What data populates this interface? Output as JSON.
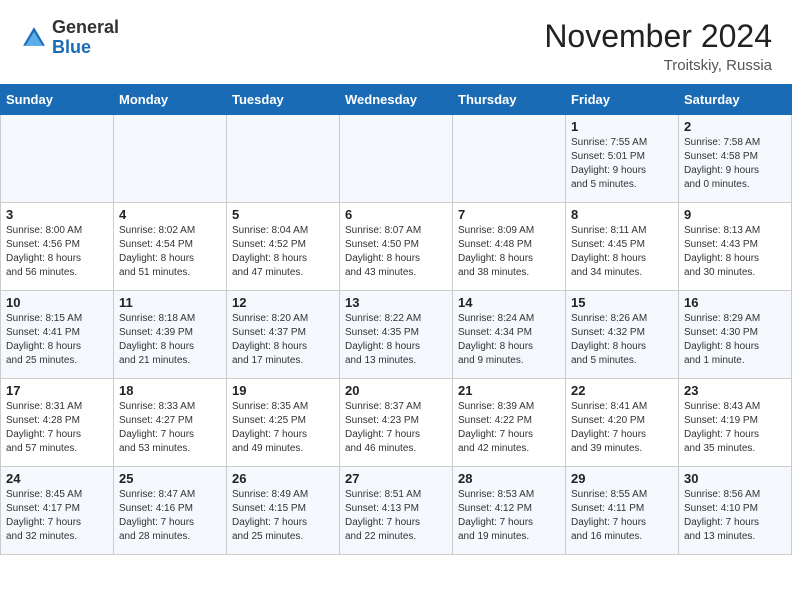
{
  "header": {
    "logo_general": "General",
    "logo_blue": "Blue",
    "month": "November 2024",
    "location": "Troitskiy, Russia"
  },
  "weekdays": [
    "Sunday",
    "Monday",
    "Tuesday",
    "Wednesday",
    "Thursday",
    "Friday",
    "Saturday"
  ],
  "weeks": [
    [
      {
        "day": "",
        "info": ""
      },
      {
        "day": "",
        "info": ""
      },
      {
        "day": "",
        "info": ""
      },
      {
        "day": "",
        "info": ""
      },
      {
        "day": "",
        "info": ""
      },
      {
        "day": "1",
        "info": "Sunrise: 7:55 AM\nSunset: 5:01 PM\nDaylight: 9 hours\nand 5 minutes."
      },
      {
        "day": "2",
        "info": "Sunrise: 7:58 AM\nSunset: 4:58 PM\nDaylight: 9 hours\nand 0 minutes."
      }
    ],
    [
      {
        "day": "3",
        "info": "Sunrise: 8:00 AM\nSunset: 4:56 PM\nDaylight: 8 hours\nand 56 minutes."
      },
      {
        "day": "4",
        "info": "Sunrise: 8:02 AM\nSunset: 4:54 PM\nDaylight: 8 hours\nand 51 minutes."
      },
      {
        "day": "5",
        "info": "Sunrise: 8:04 AM\nSunset: 4:52 PM\nDaylight: 8 hours\nand 47 minutes."
      },
      {
        "day": "6",
        "info": "Sunrise: 8:07 AM\nSunset: 4:50 PM\nDaylight: 8 hours\nand 43 minutes."
      },
      {
        "day": "7",
        "info": "Sunrise: 8:09 AM\nSunset: 4:48 PM\nDaylight: 8 hours\nand 38 minutes."
      },
      {
        "day": "8",
        "info": "Sunrise: 8:11 AM\nSunset: 4:45 PM\nDaylight: 8 hours\nand 34 minutes."
      },
      {
        "day": "9",
        "info": "Sunrise: 8:13 AM\nSunset: 4:43 PM\nDaylight: 8 hours\nand 30 minutes."
      }
    ],
    [
      {
        "day": "10",
        "info": "Sunrise: 8:15 AM\nSunset: 4:41 PM\nDaylight: 8 hours\nand 25 minutes."
      },
      {
        "day": "11",
        "info": "Sunrise: 8:18 AM\nSunset: 4:39 PM\nDaylight: 8 hours\nand 21 minutes."
      },
      {
        "day": "12",
        "info": "Sunrise: 8:20 AM\nSunset: 4:37 PM\nDaylight: 8 hours\nand 17 minutes."
      },
      {
        "day": "13",
        "info": "Sunrise: 8:22 AM\nSunset: 4:35 PM\nDaylight: 8 hours\nand 13 minutes."
      },
      {
        "day": "14",
        "info": "Sunrise: 8:24 AM\nSunset: 4:34 PM\nDaylight: 8 hours\nand 9 minutes."
      },
      {
        "day": "15",
        "info": "Sunrise: 8:26 AM\nSunset: 4:32 PM\nDaylight: 8 hours\nand 5 minutes."
      },
      {
        "day": "16",
        "info": "Sunrise: 8:29 AM\nSunset: 4:30 PM\nDaylight: 8 hours\nand 1 minute."
      }
    ],
    [
      {
        "day": "17",
        "info": "Sunrise: 8:31 AM\nSunset: 4:28 PM\nDaylight: 7 hours\nand 57 minutes."
      },
      {
        "day": "18",
        "info": "Sunrise: 8:33 AM\nSunset: 4:27 PM\nDaylight: 7 hours\nand 53 minutes."
      },
      {
        "day": "19",
        "info": "Sunrise: 8:35 AM\nSunset: 4:25 PM\nDaylight: 7 hours\nand 49 minutes."
      },
      {
        "day": "20",
        "info": "Sunrise: 8:37 AM\nSunset: 4:23 PM\nDaylight: 7 hours\nand 46 minutes."
      },
      {
        "day": "21",
        "info": "Sunrise: 8:39 AM\nSunset: 4:22 PM\nDaylight: 7 hours\nand 42 minutes."
      },
      {
        "day": "22",
        "info": "Sunrise: 8:41 AM\nSunset: 4:20 PM\nDaylight: 7 hours\nand 39 minutes."
      },
      {
        "day": "23",
        "info": "Sunrise: 8:43 AM\nSunset: 4:19 PM\nDaylight: 7 hours\nand 35 minutes."
      }
    ],
    [
      {
        "day": "24",
        "info": "Sunrise: 8:45 AM\nSunset: 4:17 PM\nDaylight: 7 hours\nand 32 minutes."
      },
      {
        "day": "25",
        "info": "Sunrise: 8:47 AM\nSunset: 4:16 PM\nDaylight: 7 hours\nand 28 minutes."
      },
      {
        "day": "26",
        "info": "Sunrise: 8:49 AM\nSunset: 4:15 PM\nDaylight: 7 hours\nand 25 minutes."
      },
      {
        "day": "27",
        "info": "Sunrise: 8:51 AM\nSunset: 4:13 PM\nDaylight: 7 hours\nand 22 minutes."
      },
      {
        "day": "28",
        "info": "Sunrise: 8:53 AM\nSunset: 4:12 PM\nDaylight: 7 hours\nand 19 minutes."
      },
      {
        "day": "29",
        "info": "Sunrise: 8:55 AM\nSunset: 4:11 PM\nDaylight: 7 hours\nand 16 minutes."
      },
      {
        "day": "30",
        "info": "Sunrise: 8:56 AM\nSunset: 4:10 PM\nDaylight: 7 hours\nand 13 minutes."
      }
    ]
  ]
}
